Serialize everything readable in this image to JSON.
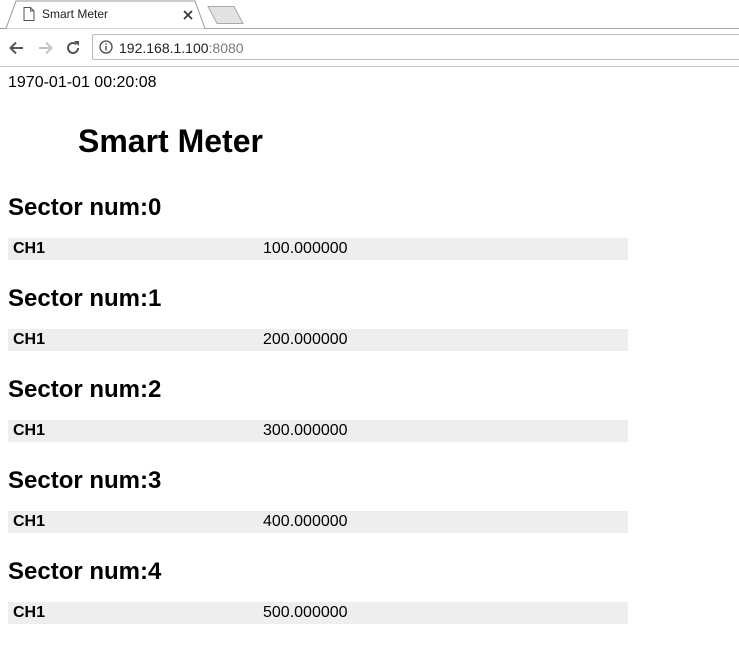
{
  "browser": {
    "tab": {
      "title": "Smart Meter"
    },
    "address_bar": {
      "host": "192.168.1.100",
      "port": ":8080"
    }
  },
  "page": {
    "timestamp": "1970-01-01 00:20:08",
    "title": "Smart Meter",
    "sectors": [
      {
        "heading": "Sector num:0",
        "channel": "CH1",
        "value": "100.000000"
      },
      {
        "heading": "Sector num:1",
        "channel": "CH1",
        "value": "200.000000"
      },
      {
        "heading": "Sector num:2",
        "channel": "CH1",
        "value": "300.000000"
      },
      {
        "heading": "Sector num:3",
        "channel": "CH1",
        "value": "400.000000"
      },
      {
        "heading": "Sector num:4",
        "channel": "CH1",
        "value": "500.000000"
      }
    ]
  }
}
